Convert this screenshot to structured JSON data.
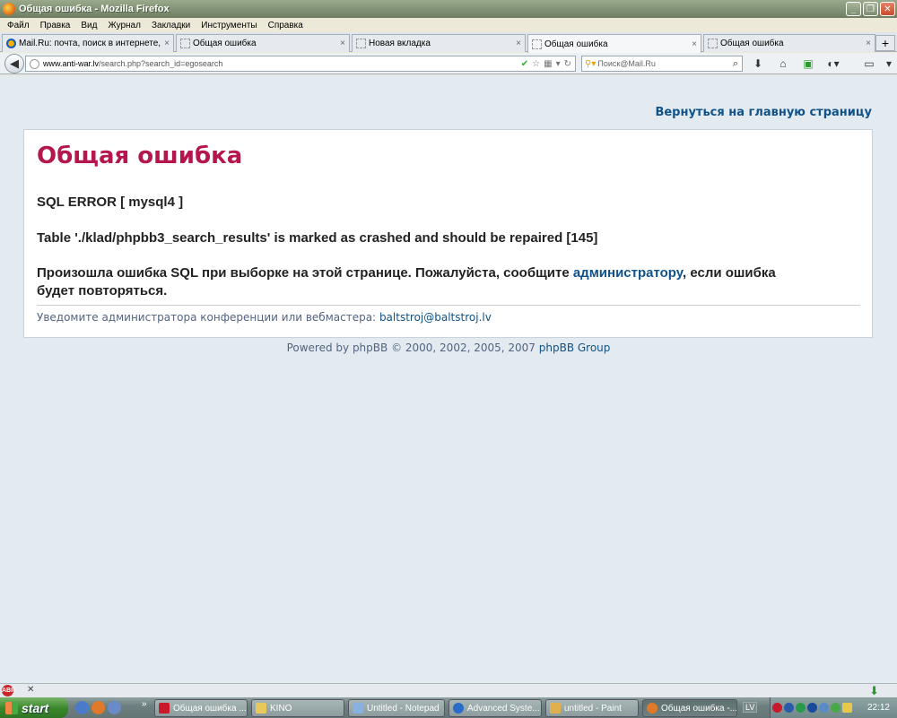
{
  "window": {
    "title": "Общая ошибка - Mozilla Firefox",
    "buttons": {
      "minimize": "_",
      "restore": "❐",
      "close": "✕"
    }
  },
  "menu": [
    "Файл",
    "Правка",
    "Вид",
    "Журнал",
    "Закладки",
    "Инструменты",
    "Справка"
  ],
  "tabs": [
    {
      "label": "Mail.Ru: почта, поиск в интернете, но...",
      "close": "×",
      "active": false
    },
    {
      "label": "Общая ошибка",
      "close": "×",
      "active": false
    },
    {
      "label": "Новая вкладка",
      "close": "×",
      "active": false
    },
    {
      "label": "Общая ошибка",
      "close": "×",
      "active": true
    },
    {
      "label": "Общая ошибка",
      "close": "×",
      "active": false
    }
  ],
  "new_tab": "+",
  "nav": {
    "url_domain": "www.anti-war.lv",
    "url_path": "/search.php?search_id=egosearch",
    "search_placeholder": "Поиск@Mail.Ru"
  },
  "page": {
    "home_link": "Вернуться на главную страницу",
    "error_title": "Общая ошибка",
    "sql_error": "SQL ERROR [ mysql4 ]",
    "table_message": "Table './klad/phpbb3_search_results' is marked as crashed and should be repaired [145]",
    "sql_message_before": "Произошла ошибка SQL при выборке на этой странице. Пожалуйста, сообщите",
    "admin_link": "администратору",
    "sql_message_after": ", если ошибка",
    "sql_message_line2": "будет повторяться.",
    "notify_text": "Уведомите администратора конференции или вебмастера:",
    "notify_email": "baltstroj@baltstroj.lv",
    "footer_text": "Powered by phpBB © 2000, 2002, 2005, 2007",
    "footer_link": "phpBB Group"
  },
  "taskbar": {
    "start": "start",
    "tasks": [
      {
        "label": "Общая ошибка ...",
        "active": false
      },
      {
        "label": "KINO",
        "active": false
      },
      {
        "label": "Untitled - Notepad",
        "active": false
      },
      {
        "label": "Advanced Syste...",
        "active": false
      },
      {
        "label": "untitled - Paint",
        "active": false
      },
      {
        "label": "Общая ошибка -...",
        "active": true
      }
    ],
    "language": "LV",
    "clock": "22:12"
  },
  "colors": {
    "error_title": "#b6164e",
    "link": "#105289",
    "page_bg": "#e3ebf0"
  }
}
